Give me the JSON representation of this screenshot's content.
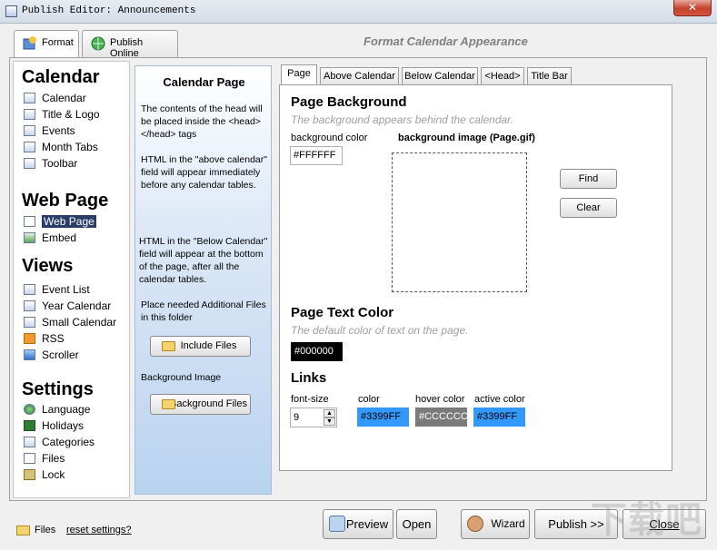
{
  "window": {
    "title": "Publish Editor: Announcements",
    "close_glyph": "✕"
  },
  "outer_tabs": [
    {
      "label": "Format"
    },
    {
      "label": "Publish Online"
    }
  ],
  "header_caption": "Format Calendar Appearance",
  "sidebar": {
    "sections": [
      {
        "title": "Calendar",
        "items": [
          "Calendar",
          "Title & Logo",
          "Events",
          "Month Tabs",
          "Toolbar"
        ]
      },
      {
        "title": "Web Page",
        "items": [
          "Web Page",
          "Embed"
        ]
      },
      {
        "title": "Views",
        "items": [
          "Event List",
          "Year Calendar",
          "Small Calendar",
          "RSS",
          "Scroller"
        ]
      },
      {
        "title": "Settings",
        "items": [
          "Language",
          "Holidays",
          "Categories",
          "Files",
          "Lock"
        ]
      }
    ],
    "selected": "Web Page"
  },
  "help": {
    "title": "Calendar Page",
    "p1": "The contents of the head will be placed inside the <head></head> tags",
    "p2": "HTML in the \"above calendar\" field will appear immediately before any calendar tables.",
    "p3": "HTML in the \"Below Calendar\" field will appear at the bottom of the page, after all the calendar tables.",
    "p4": "Place needed Additional Files in this folder",
    "include_files": "Include Files",
    "bg_image_label": "Background Image",
    "background_files": "Background Files"
  },
  "inner_tabs": [
    "Page",
    "Above Calendar",
    "Below Calendar",
    "<Head>",
    "Title Bar"
  ],
  "page": {
    "bg_heading": "Page Background",
    "bg_sub": "The background appears behind the calendar.",
    "bg_color_label": "background color",
    "bg_color_value": "#FFFFFF",
    "bg_image_label": "background image (Page.gif)",
    "find": "Find",
    "clear": "Clear",
    "text_heading": "Page Text Color",
    "text_sub": "The default color of text on the page.",
    "text_color_value": "#000000",
    "links_heading": "Links",
    "font_size_label": "font-size",
    "font_size_value": "9",
    "color_label": "color",
    "color_value": "#3399FF",
    "hover_label": "hover color",
    "hover_value": "#CCCCCC",
    "active_label": "active color",
    "active_value": "#3399FF"
  },
  "footer": {
    "files": "Files",
    "reset": "reset settings?",
    "preview": "Preview",
    "open": "Open",
    "wizard": "Wizard",
    "publish": "Publish >>",
    "close": "Close"
  },
  "watermark": "下载吧",
  "colors": {
    "link": "#3399FF",
    "hover": "#CCCCCC",
    "text": "#000000",
    "selected_nav": "#2b3d66"
  }
}
